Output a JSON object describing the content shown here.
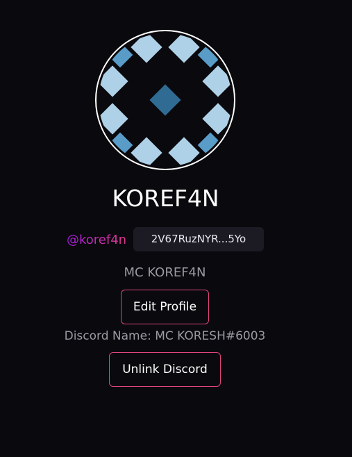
{
  "profile": {
    "display_name": "KOREF4N",
    "handle": "@koref4n",
    "wallet_address": "2V67RuzNYR...5Yo",
    "subname": "MC KOREF4N",
    "edit_profile_label": "Edit Profile",
    "discord_name": "Discord Name: MC KORESH#6003",
    "unlink_discord_label": "Unlink Discord"
  },
  "colors": {
    "background": "#0a090d",
    "accent_border": "#e0457f",
    "handle_gradient_start": "#a21cdf",
    "handle_gradient_end": "#e23a8c",
    "avatar_tile_light": "#aed1e7",
    "avatar_tile_medium": "#5a9cc8",
    "avatar_tile_dark": "#2f6b93"
  }
}
